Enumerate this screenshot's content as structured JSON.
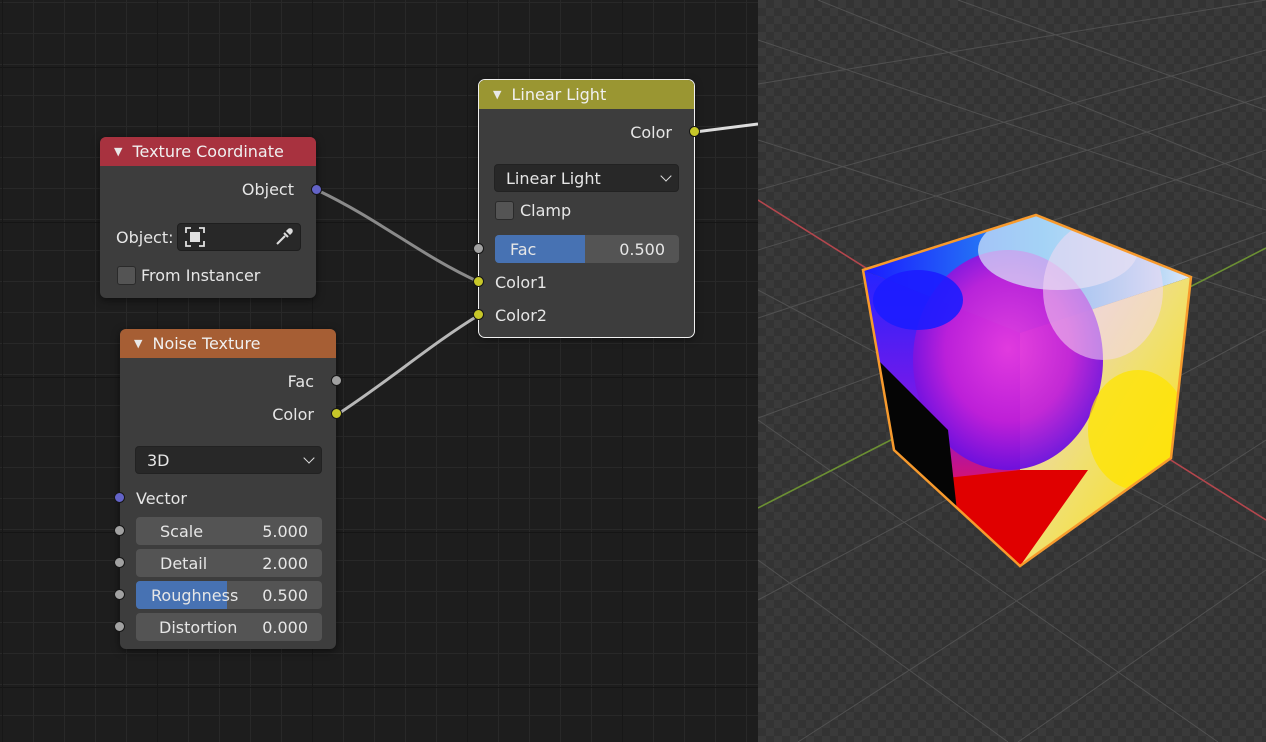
{
  "colors": {
    "editor_bg": "#1d1d1d",
    "node_bg": "#3d3d3d",
    "header_texture_coordinate": "#a8323f",
    "header_noise_texture": "#a65e34",
    "header_linear_light": "#9a9632",
    "socket_color": "#c7c729",
    "socket_vector": "#6363c7",
    "socket_float": "#a1a1a1",
    "slider_fill": "#4772b3",
    "selection_outline": "#f79a2d"
  },
  "texture_coordinate": {
    "title": "Texture Coordinate",
    "output_object": "Object",
    "object_label": "Object:",
    "object_field_icon": "object-square-icon",
    "eyedropper_icon": "eyedropper-icon",
    "from_instancer": "From Instancer",
    "from_instancer_checked": false
  },
  "noise_texture": {
    "title": "Noise Texture",
    "output_fac": "Fac",
    "output_color": "Color",
    "dimensions": "3D",
    "input_vector": "Vector",
    "inputs": [
      {
        "label": "Scale",
        "value": "5.000",
        "fill": 0
      },
      {
        "label": "Detail",
        "value": "2.000",
        "fill": 0
      },
      {
        "label": "Roughness",
        "value": "0.500",
        "fill": 0.5
      },
      {
        "label": "Distortion",
        "value": "0.000",
        "fill": 0
      }
    ]
  },
  "linear_light": {
    "title": "Linear Light",
    "output_color": "Color",
    "blend_mode": "Linear Light",
    "clamp": "Clamp",
    "clamp_checked": false,
    "fac_label": "Fac",
    "fac_value": "0.500",
    "fac_fill": 0.5,
    "input_color1": "Color1",
    "input_color2": "Color2"
  }
}
